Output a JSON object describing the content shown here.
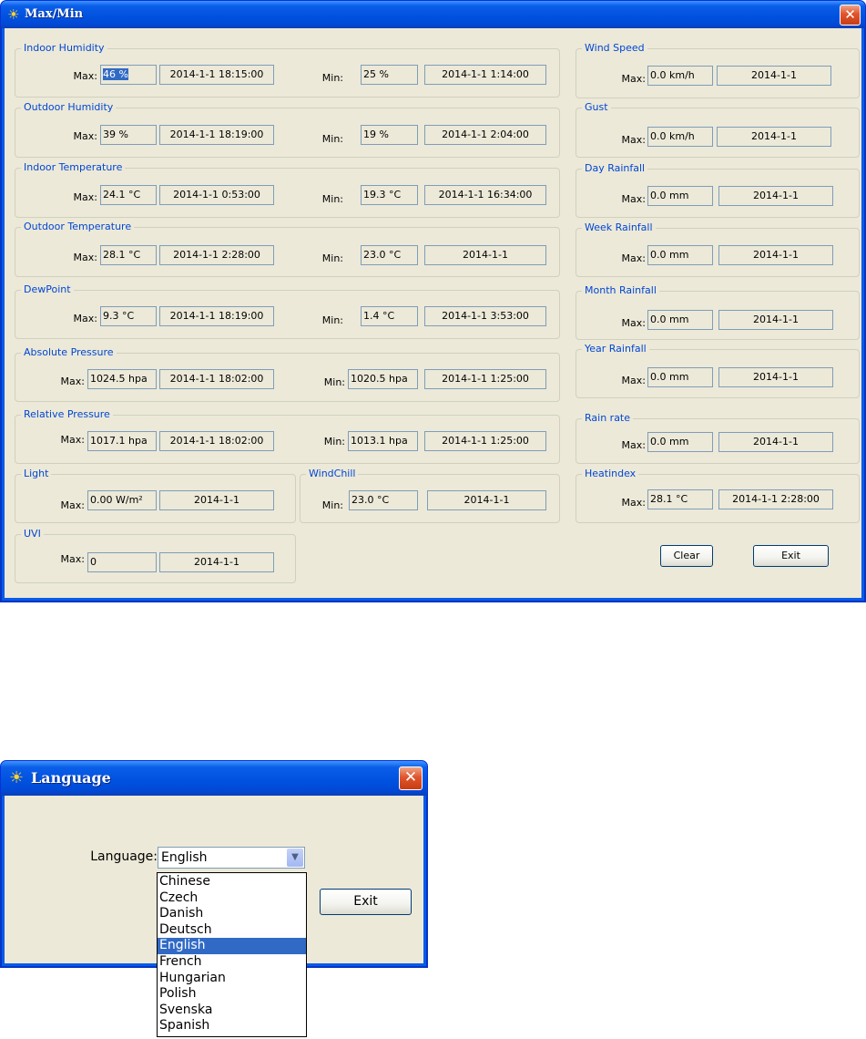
{
  "maxmin": {
    "title": "Max/Min",
    "close": "✕",
    "max_label": "Max:",
    "min_label": "Min:",
    "indoor_humidity": {
      "label": "Indoor Humidity",
      "max": "46 %",
      "max_time": "2014-1-1 18:15:00",
      "min": "25 %",
      "min_time": "2014-1-1 1:14:00"
    },
    "outdoor_humidity": {
      "label": "Outdoor Humidity",
      "max": "39 %",
      "max_time": "2014-1-1 18:19:00",
      "min": "19 %",
      "min_time": "2014-1-1 2:04:00"
    },
    "indoor_temperature": {
      "label": "Indoor Temperature",
      "max": "24.1 °C",
      "max_time": "2014-1-1 0:53:00",
      "min": "19.3 °C",
      "min_time": "2014-1-1 16:34:00"
    },
    "outdoor_temperature": {
      "label": "Outdoor Temperature",
      "max": "28.1 °C",
      "max_time": "2014-1-1 2:28:00",
      "min": "23.0 °C",
      "min_time": "2014-1-1"
    },
    "dewpoint": {
      "label": "DewPoint",
      "max": "9.3 °C",
      "max_time": "2014-1-1 18:19:00",
      "min": "1.4 °C",
      "min_time": "2014-1-1 3:53:00"
    },
    "absolute_pressure": {
      "label": "Absolute Pressure",
      "max": "1024.5 hpa",
      "max_time": "2014-1-1 18:02:00",
      "min": "1020.5 hpa",
      "min_time": "2014-1-1 1:25:00"
    },
    "relative_pressure": {
      "label": "Relative Pressure",
      "max": "1017.1 hpa",
      "max_time": "2014-1-1 18:02:00",
      "min": "1013.1 hpa",
      "min_time": "2014-1-1 1:25:00"
    },
    "light": {
      "label": "Light",
      "max": "0.00 W/m²",
      "max_time": "2014-1-1"
    },
    "windchill": {
      "label": "WindChill",
      "min": "23.0 °C",
      "min_time": "2014-1-1"
    },
    "uvi": {
      "label": "UVI",
      "max": "0",
      "max_time": "2014-1-1"
    },
    "wind_speed": {
      "label": "Wind Speed",
      "max": "0.0 km/h",
      "max_time": "2014-1-1"
    },
    "gust": {
      "label": "Gust",
      "max": "0.0 km/h",
      "max_time": "2014-1-1"
    },
    "day_rainfall": {
      "label": "Day Rainfall",
      "max": "0.0 mm",
      "max_time": "2014-1-1"
    },
    "week_rainfall": {
      "label": "Week Rainfall",
      "max": "0.0 mm",
      "max_time": "2014-1-1"
    },
    "month_rainfall": {
      "label": "Month Rainfall",
      "max": "0.0 mm",
      "max_time": "2014-1-1"
    },
    "year_rainfall": {
      "label": "Year Rainfall",
      "max": "0.0 mm",
      "max_time": "2014-1-1"
    },
    "rain_rate": {
      "label": "Rain rate",
      "max": "0.0 mm",
      "max_time": "2014-1-1"
    },
    "heatindex": {
      "label": "Heatindex",
      "max": "28.1 °C",
      "max_time": "2014-1-1 2:28:00"
    },
    "clear_button": "Clear",
    "exit_button": "Exit"
  },
  "language": {
    "title": "Language",
    "close": "✕",
    "label": "Language:",
    "selected": "English",
    "exit_button": "Exit",
    "options": [
      "Chinese",
      "Czech",
      "Danish",
      "Deutsch",
      "English",
      "French",
      "Hungarian",
      "Polish",
      "Svenska",
      "Spanish"
    ],
    "highlighted_index": 4
  }
}
